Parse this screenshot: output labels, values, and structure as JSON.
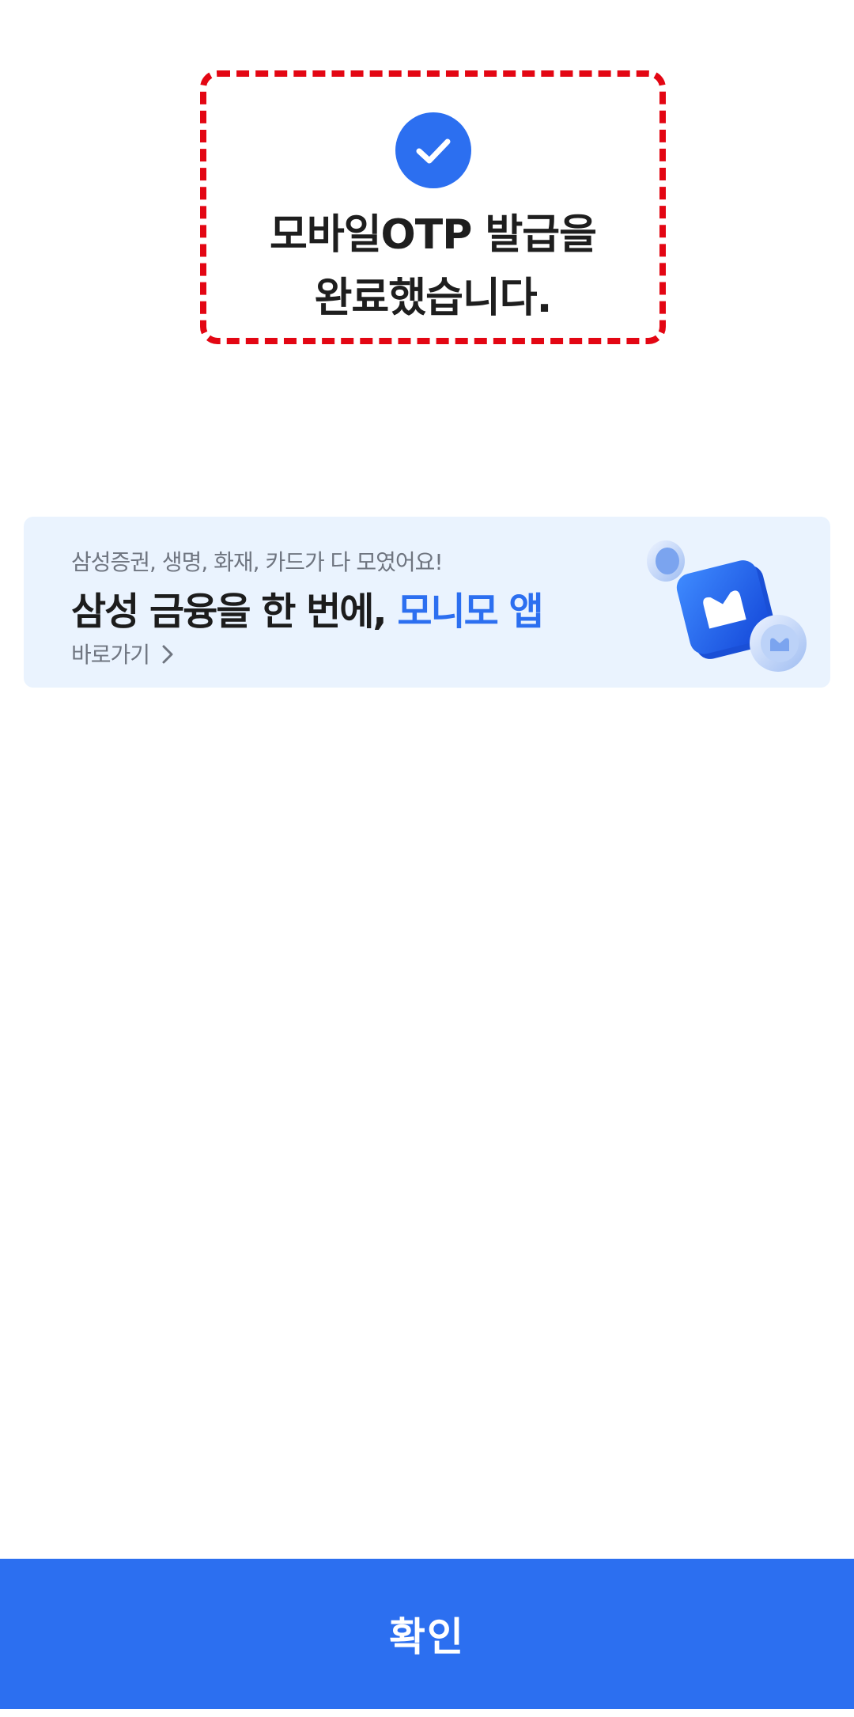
{
  "completion": {
    "icon": "check-icon",
    "title_line1": "모바일OTP 발급을",
    "title_line2": "완료했습니다."
  },
  "banner": {
    "subtitle": "삼성증권, 생명, 화재, 카드가 다 모였어요!",
    "title_main": "삼성 금융을 한 번에, ",
    "title_accent": "모니모 앱",
    "link_label": "바로가기",
    "link_icon": "chevron-right-icon",
    "art_icon": "monimo-app-icon"
  },
  "footer": {
    "confirm_label": "확인"
  },
  "colors": {
    "accent": "#2c6ff0",
    "highlight": "#e30613",
    "banner_bg": "#eaf3fe"
  }
}
